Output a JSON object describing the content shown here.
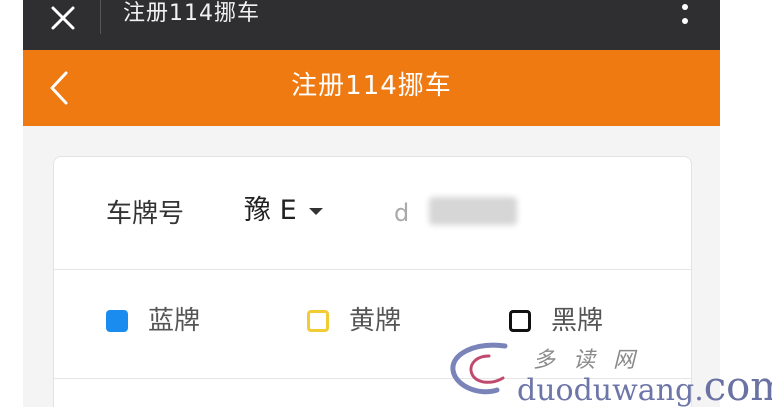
{
  "topbar": {
    "title": "注册114挪车",
    "close_icon": "close-icon",
    "more_icon": "more-vertical-icon"
  },
  "navbar": {
    "title": "注册114挪车",
    "back_icon": "chevron-left-icon"
  },
  "form": {
    "plate_label": "车牌号",
    "province_value": "豫 E",
    "plate_input_value": "d",
    "plate_colors": [
      {
        "label": "蓝牌",
        "color": "#1a8cf0",
        "selected": true
      },
      {
        "label": "黄牌",
        "color": "#f2cc35",
        "selected": false
      },
      {
        "label": "黑牌",
        "color": "#111111",
        "selected": false
      }
    ]
  },
  "watermark": {
    "cn": "多读网",
    "en_prefix": "duoduwang.",
    "en_suffix": "com"
  },
  "colors": {
    "topbar_bg": "#2f2f31",
    "accent_orange": "#ee7a11",
    "page_bg": "#f4f4f4"
  }
}
